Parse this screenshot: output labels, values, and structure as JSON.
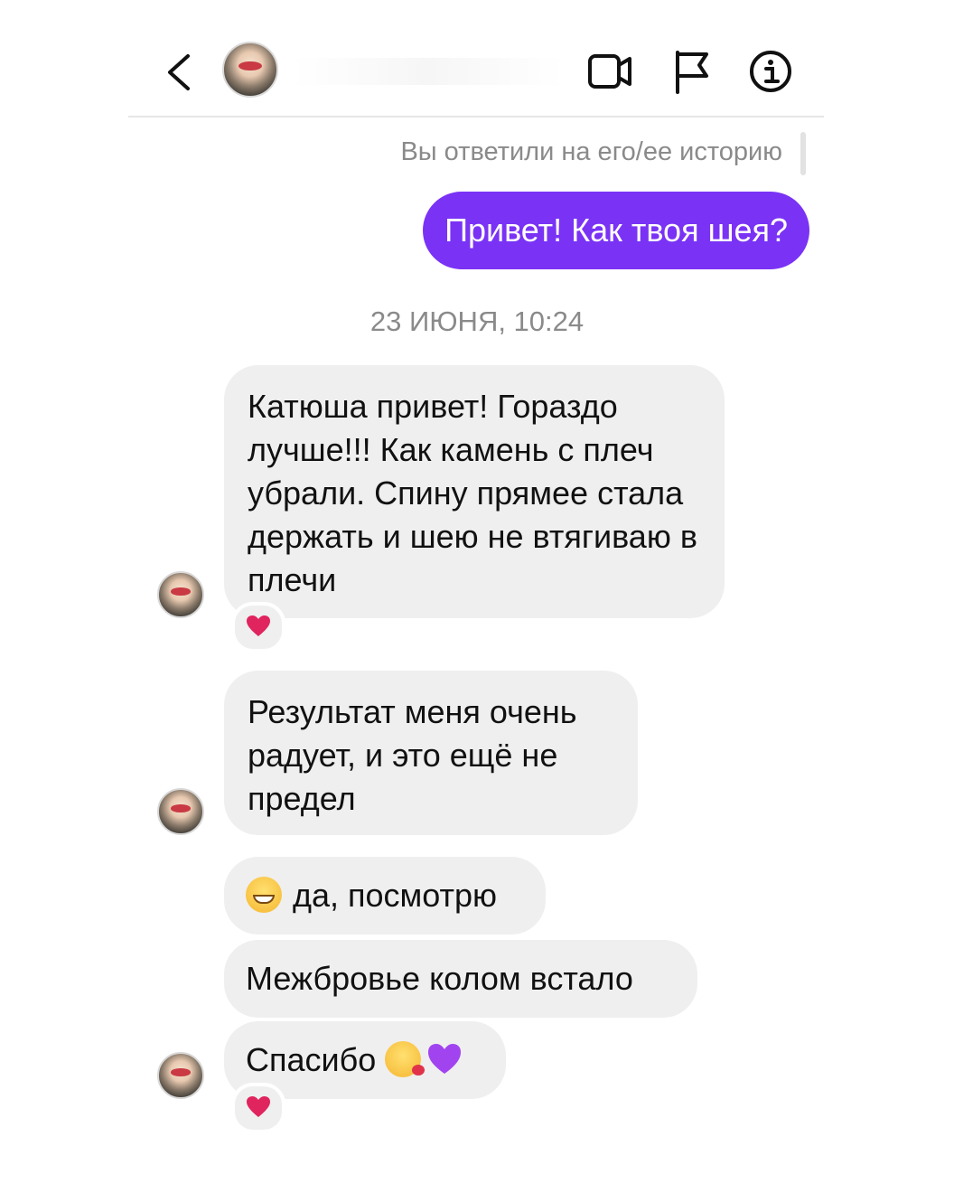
{
  "header": {
    "back_icon": "chevron-left-icon",
    "actions": [
      "video-call-icon",
      "report-flag-icon",
      "info-icon"
    ]
  },
  "thread": {
    "story_reply_note": "Вы ответили на его/ее историю",
    "outgoing_message": "Привет! Как твоя шея?",
    "timestamp": "23 ИЮНЯ, 10:24",
    "incoming": [
      "Катюша привет! Гораздо лучше!!! Как камень с плеч убрали. Спину прямее стала держать и шею не втягиваю в плечи",
      "Результат меня очень радует, и это ещё не предел",
      "да, посмотрю",
      "Межбровье колом встало",
      "Спасибо"
    ],
    "reactions": [
      "red-heart",
      "red-heart"
    ]
  },
  "colors": {
    "outgoing_bubble": "#7a32f5",
    "incoming_bubble": "#efefef",
    "reaction_heart": "#e0245e",
    "purple_heart": "#a144f0"
  }
}
